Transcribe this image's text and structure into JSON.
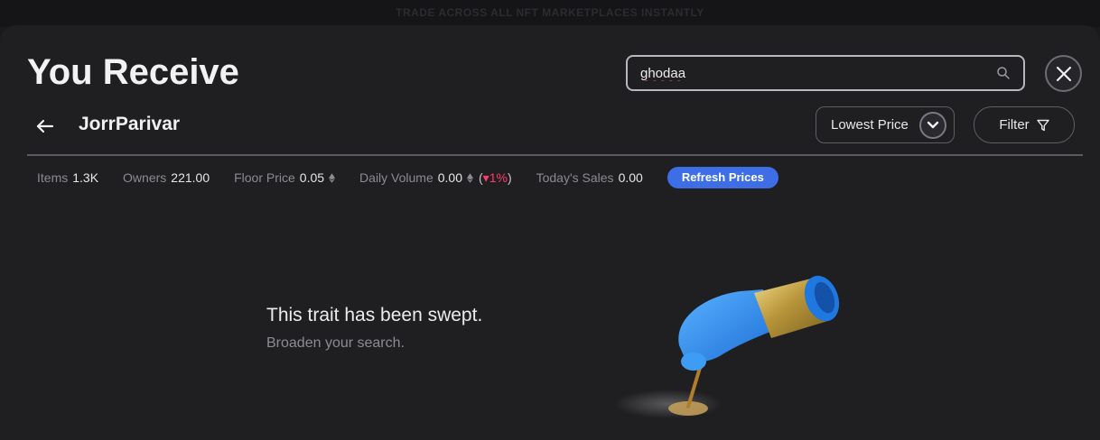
{
  "banner": {
    "text": "TRADE ACROSS ALL NFT MARKETPLACES INSTANTLY"
  },
  "header": {
    "title": "You Receive"
  },
  "search": {
    "value": "ghodaa",
    "placeholder": ""
  },
  "collection": {
    "name": "JorrParivar"
  },
  "sort": {
    "label": "Lowest Price"
  },
  "filter": {
    "label": "Filter"
  },
  "stats": {
    "items_label": "Items",
    "items_value": "1.3K",
    "owners_label": "Owners",
    "owners_value": "221.00",
    "floor_label": "Floor Price",
    "floor_value": "0.05",
    "volume_label": "Daily Volume",
    "volume_value": "0.00",
    "volume_change_open": "(",
    "volume_change": "▾1%",
    "volume_change_close": ")",
    "sales_label": "Today's Sales",
    "sales_value": "0.00"
  },
  "refresh": {
    "label": "Refresh Prices"
  },
  "empty": {
    "title": "This trait has been swept.",
    "subtitle": "Broaden your search."
  },
  "colors": {
    "accent": "#3d6ee6",
    "negative": "#ff3b6b",
    "glove": "#2f8ff0",
    "cuff": "#c9a94a"
  },
  "icons": [
    "search-icon",
    "close-icon",
    "back-arrow-icon",
    "chevron-down-icon",
    "filter-icon",
    "eth-icon"
  ]
}
